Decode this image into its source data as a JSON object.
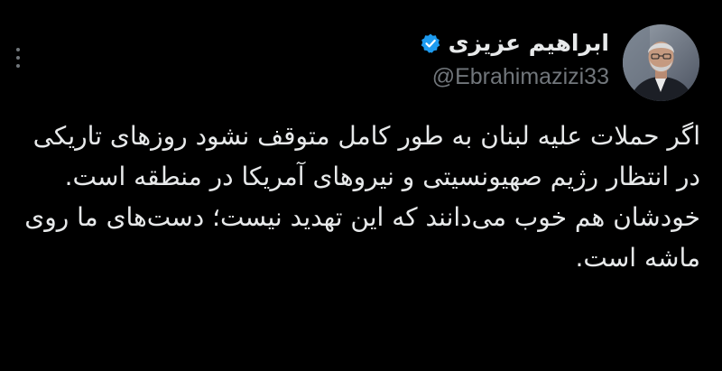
{
  "tweet": {
    "author": {
      "display_name": "ابراهیم عزیزی",
      "handle": "@Ebrahimazizi33",
      "verified": true,
      "verified_color": "#1d9bf0",
      "avatar_icon": "user-avatar"
    },
    "paragraphs": [
      "اگر حملات علیه لبنان به طور کامل متوقف نشود روزهای تاریکی در انتظار رژیم صهیونسیتی و نیروهای آمریکا در منطقه است.",
      "خودشان هم خوب می‌دانند که این تهدید نیست؛ دست‌های ما روی ماشه است."
    ],
    "more_icon": "more-dots-icon"
  },
  "theme": {
    "background": "#000000",
    "text": "#e7e9ea",
    "muted": "#71767b"
  }
}
